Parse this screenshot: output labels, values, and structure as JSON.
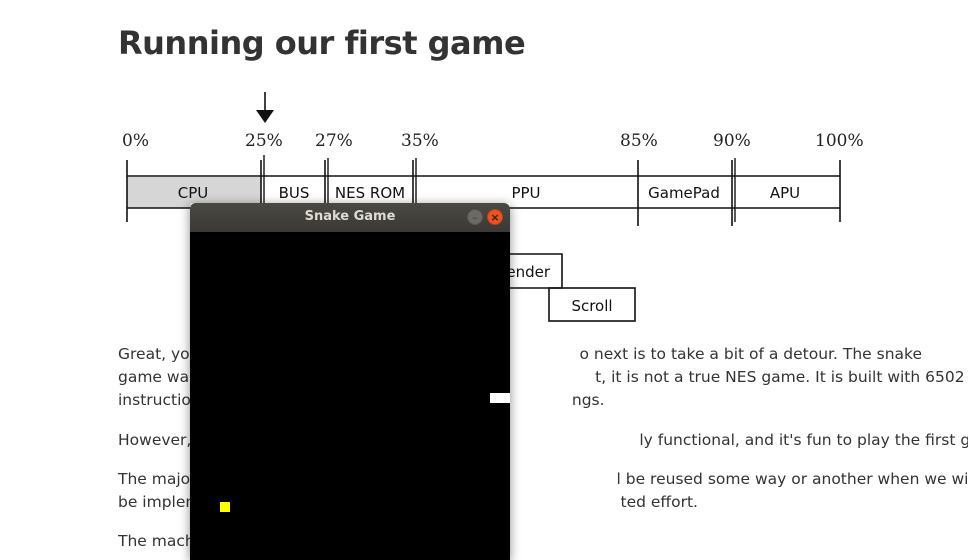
{
  "page": {
    "title": "Running our first game"
  },
  "progress": {
    "marker_percent": 25,
    "ticks": [
      "0%",
      "25%",
      "27%",
      "35%",
      "85%",
      "90%",
      "100%"
    ],
    "segments": [
      {
        "label": "CPU",
        "from": 0,
        "to": 25,
        "done": true
      },
      {
        "label": "BUS",
        "from": 25,
        "to": 27,
        "done": false
      },
      {
        "label": "NES ROM",
        "from": 27,
        "to": 35,
        "done": false
      },
      {
        "label": "PPU",
        "from": 35,
        "to": 85,
        "done": false
      },
      {
        "label": "GamePad",
        "from": 85,
        "to": 90,
        "done": false
      },
      {
        "label": "APU",
        "from": 90,
        "to": 100,
        "done": false
      }
    ],
    "sub_boxes": [
      "ender",
      "Scroll"
    ]
  },
  "paragraphs": {
    "p1": {
      "l1a": "Great, you",
      "l1b": "o next is to take a bit of a detour. The snake",
      "l2a": "game was",
      "l2b": "t, it is not a true NES game. It is built with 6502",
      "l3a": "instructio",
      "l3b": "ngs."
    },
    "p2": {
      "l1a": "However,",
      "l1b": "ly functional, and it's fun to play the first game."
    },
    "p3": {
      "l1a": "The major",
      "l1b": "l be reused some way or another when we will",
      "l2a": "be implem",
      "l2b": "ted effort."
    },
    "p4": {
      "l1a": "The mach"
    }
  },
  "game_window": {
    "title": "Snake Game",
    "minimize_icon": "minimize-icon",
    "close_icon": "close-icon",
    "colors": {
      "background": "#000000",
      "food": "#ffff00",
      "snake": "#ffffff"
    }
  }
}
